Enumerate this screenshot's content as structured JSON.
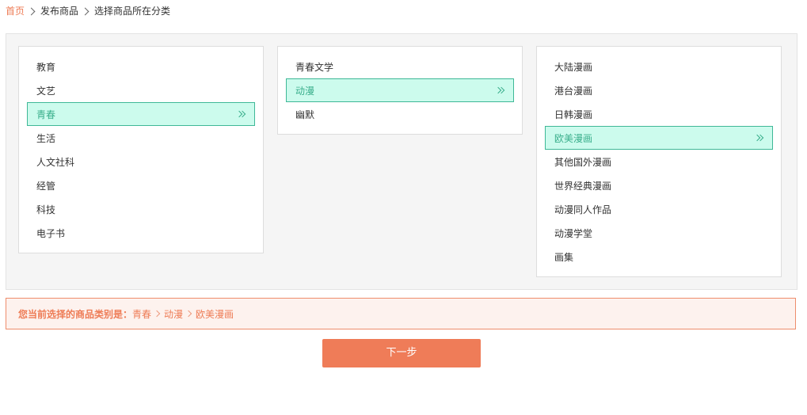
{
  "breadcrumb": {
    "home": "首页",
    "publish": "发布商品",
    "current": "选择商品所在分类"
  },
  "categories": {
    "level1": {
      "items": [
        "教育",
        "文艺",
        "青春",
        "生活",
        "人文社科",
        "经管",
        "科技",
        "电子书"
      ],
      "selected_index": 2
    },
    "level2": {
      "items": [
        "青春文学",
        "动漫",
        "幽默"
      ],
      "selected_index": 1
    },
    "level3": {
      "items": [
        "大陆漫画",
        "港台漫画",
        "日韩漫画",
        "欧美漫画",
        "其他国外漫画",
        "世界经典漫画",
        "动漫同人作品",
        "动漫学堂",
        "画集"
      ],
      "selected_index": 3
    }
  },
  "selection": {
    "label": "您当前选择的商品类别是：",
    "path": [
      "青春",
      "动漫",
      "欧美漫画"
    ]
  },
  "actions": {
    "next_label": "下一步"
  },
  "colors": {
    "accent": "#ef7c58",
    "selected_bg": "#ccfbed",
    "selected_border": "#3fb897",
    "selected_text": "#3aaf8c"
  }
}
